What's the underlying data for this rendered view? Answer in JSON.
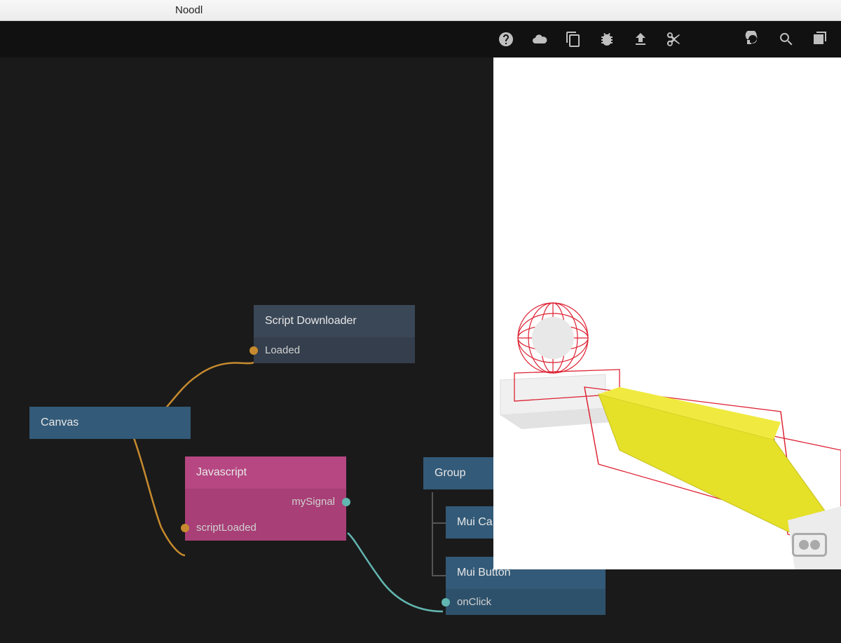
{
  "app": {
    "title": "Noodl"
  },
  "toolbar": {
    "icons": [
      "help",
      "cloud",
      "copy",
      "bug",
      "upload",
      "cut",
      "refresh",
      "search",
      "duplicate"
    ]
  },
  "nodes": {
    "canvas": {
      "title": "Canvas"
    },
    "scriptDownloader": {
      "title": "Script Downloader",
      "port_out": "Loaded"
    },
    "javascript": {
      "title": "Javascript",
      "port_out": "mySignal",
      "port_in": "scriptLoaded"
    },
    "group": {
      "title": "Group"
    },
    "muiCa": {
      "title": "Mui Ca"
    },
    "muiButton": {
      "title": "Mui Button",
      "port_in": "onClick"
    }
  },
  "colors": {
    "edge_orange": "#c78a2e",
    "edge_teal": "#62b6b0",
    "port_orange": "#c78a2e",
    "port_teal": "#62b6b0"
  }
}
